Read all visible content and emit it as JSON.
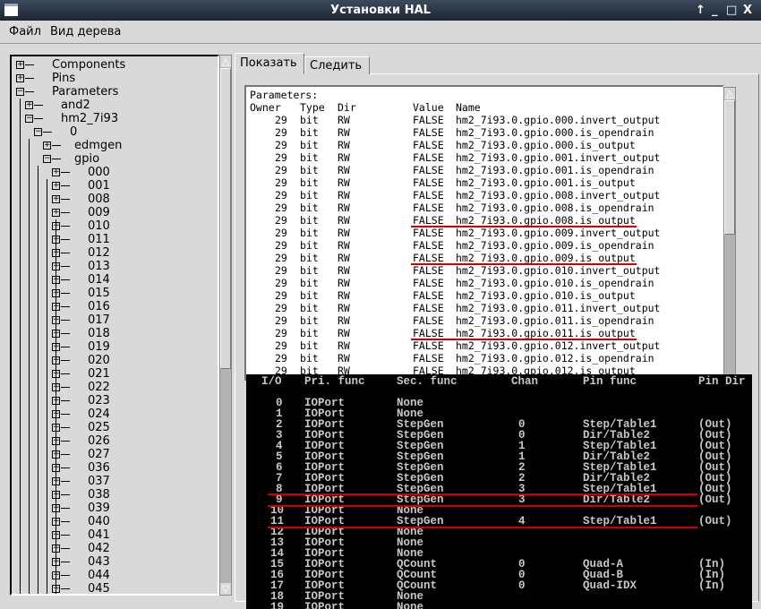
{
  "window": {
    "title": "Установки HAL",
    "controls": [
      "↑",
      "_",
      "□",
      "X"
    ]
  },
  "menu": [
    "Файл",
    "Вид дерева"
  ],
  "tree": {
    "items": [
      {
        "label": "Components",
        "depth": 0,
        "expanded": false
      },
      {
        "label": "Pins",
        "depth": 0,
        "expanded": false
      },
      {
        "label": "Parameters",
        "depth": 0,
        "expanded": true
      },
      {
        "label": "and2",
        "depth": 1,
        "expanded": false
      },
      {
        "label": "hm2_7i93",
        "depth": 1,
        "expanded": true
      },
      {
        "label": "0",
        "depth": 2,
        "expanded": true
      },
      {
        "label": "edmgen",
        "depth": 3,
        "expanded": false
      },
      {
        "label": "gpio",
        "depth": 3,
        "expanded": true
      },
      {
        "label": "000",
        "depth": 4
      },
      {
        "label": "001",
        "depth": 4
      },
      {
        "label": "008",
        "depth": 4
      },
      {
        "label": "009",
        "depth": 4
      },
      {
        "label": "010",
        "depth": 4
      },
      {
        "label": "011",
        "depth": 4
      },
      {
        "label": "012",
        "depth": 4
      },
      {
        "label": "013",
        "depth": 4
      },
      {
        "label": "014",
        "depth": 4
      },
      {
        "label": "015",
        "depth": 4
      },
      {
        "label": "016",
        "depth": 4
      },
      {
        "label": "017",
        "depth": 4
      },
      {
        "label": "018",
        "depth": 4
      },
      {
        "label": "019",
        "depth": 4
      },
      {
        "label": "020",
        "depth": 4
      },
      {
        "label": "021",
        "depth": 4
      },
      {
        "label": "022",
        "depth": 4
      },
      {
        "label": "023",
        "depth": 4
      },
      {
        "label": "024",
        "depth": 4
      },
      {
        "label": "025",
        "depth": 4
      },
      {
        "label": "026",
        "depth": 4
      },
      {
        "label": "027",
        "depth": 4
      },
      {
        "label": "036",
        "depth": 4
      },
      {
        "label": "037",
        "depth": 4
      },
      {
        "label": "038",
        "depth": 4
      },
      {
        "label": "039",
        "depth": 4
      },
      {
        "label": "040",
        "depth": 4
      },
      {
        "label": "041",
        "depth": 4
      },
      {
        "label": "042",
        "depth": 4
      },
      {
        "label": "043",
        "depth": 4
      },
      {
        "label": "044",
        "depth": 4
      },
      {
        "label": "045",
        "depth": 4
      }
    ]
  },
  "tabs": [
    {
      "label": "Показать",
      "active": true
    },
    {
      "label": "Следить",
      "active": false
    }
  ],
  "params": {
    "heading": "Parameters:",
    "columns": [
      "Owner",
      "Type",
      "Dir",
      "Value",
      "Name"
    ],
    "rows": [
      [
        "29",
        "bit",
        "RW",
        "FALSE",
        "hm2_7i93.0.gpio.000.invert_output",
        false
      ],
      [
        "29",
        "bit",
        "RW",
        "FALSE",
        "hm2_7i93.0.gpio.000.is_opendrain",
        false
      ],
      [
        "29",
        "bit",
        "RW",
        "FALSE",
        "hm2_7i93.0.gpio.000.is_output",
        false
      ],
      [
        "29",
        "bit",
        "RW",
        "FALSE",
        "hm2_7i93.0.gpio.001.invert_output",
        false
      ],
      [
        "29",
        "bit",
        "RW",
        "FALSE",
        "hm2_7i93.0.gpio.001.is_opendrain",
        false
      ],
      [
        "29",
        "bit",
        "RW",
        "FALSE",
        "hm2_7i93.0.gpio.001.is_output",
        false
      ],
      [
        "29",
        "bit",
        "RW",
        "FALSE",
        "hm2_7i93.0.gpio.008.invert_output",
        false
      ],
      [
        "29",
        "bit",
        "RW",
        "FALSE",
        "hm2_7i93.0.gpio.008.is_opendrain",
        false
      ],
      [
        "29",
        "bit",
        "RW",
        "FALSE",
        "hm2_7i93.0.gpio.008.is_output",
        true
      ],
      [
        "29",
        "bit",
        "RW",
        "FALSE",
        "hm2_7i93.0.gpio.009.invert_output",
        false
      ],
      [
        "29",
        "bit",
        "RW",
        "FALSE",
        "hm2_7i93.0.gpio.009.is_opendrain",
        false
      ],
      [
        "29",
        "bit",
        "RW",
        "FALSE",
        "hm2_7i93.0.gpio.009.is_output",
        true
      ],
      [
        "29",
        "bit",
        "RW",
        "FALSE",
        "hm2_7i93.0.gpio.010.invert_output",
        false
      ],
      [
        "29",
        "bit",
        "RW",
        "FALSE",
        "hm2_7i93.0.gpio.010.is_opendrain",
        false
      ],
      [
        "29",
        "bit",
        "RW",
        "FALSE",
        "hm2_7i93.0.gpio.010.is_output",
        false
      ],
      [
        "29",
        "bit",
        "RW",
        "FALSE",
        "hm2_7i93.0.gpio.011.invert_output",
        false
      ],
      [
        "29",
        "bit",
        "RW",
        "FALSE",
        "hm2_7i93.0.gpio.011.is_opendrain",
        false
      ],
      [
        "29",
        "bit",
        "RW",
        "FALSE",
        "hm2_7i93.0.gpio.011.is_output",
        true
      ],
      [
        "29",
        "bit",
        "RW",
        "FALSE",
        "hm2_7i93.0.gpio.012.invert_output",
        false
      ],
      [
        "29",
        "bit",
        "RW",
        "FALSE",
        "hm2_7i93.0.gpio.012.is_opendrain",
        false
      ],
      [
        "29",
        "bit",
        "RW",
        "FALSE",
        "hm2_7i93.0.gpio.012.is_output",
        false
      ]
    ]
  },
  "pinout": {
    "columns": [
      "I/O",
      "Pri. func",
      "Sec. func",
      "Chan",
      "Pin func",
      "Pin Dir"
    ],
    "rows": [
      [
        "0",
        "IOPort",
        "None",
        "",
        "",
        ""
      ],
      [
        "1",
        "IOPort",
        "None",
        "",
        "",
        ""
      ],
      [
        "2",
        "IOPort",
        "StepGen",
        "0",
        "Step/Table1",
        "(Out)"
      ],
      [
        "3",
        "IOPort",
        "StepGen",
        "0",
        "Dir/Table2",
        "(Out)"
      ],
      [
        "4",
        "IOPort",
        "StepGen",
        "1",
        "Step/Table1",
        "(Out)"
      ],
      [
        "5",
        "IOPort",
        "StepGen",
        "1",
        "Dir/Table2",
        "(Out)"
      ],
      [
        "6",
        "IOPort",
        "StepGen",
        "2",
        "Step/Table1",
        "(Out)"
      ],
      [
        "7",
        "IOPort",
        "StepGen",
        "2",
        "Dir/Table2",
        "(Out)"
      ],
      [
        "8",
        "IOPort",
        "StepGen",
        "3",
        "Step/Table1",
        "(Out)"
      ],
      [
        "9",
        "IOPort",
        "StepGen",
        "3",
        "Dir/Table2",
        "(Out)"
      ],
      [
        "10",
        "IOPort",
        "None",
        "",
        "",
        ""
      ],
      [
        "11",
        "IOPort",
        "StepGen",
        "4",
        "Step/Table1",
        "(Out)"
      ],
      [
        "12",
        "IOPort",
        "None",
        "",
        "",
        ""
      ],
      [
        "13",
        "IOPort",
        "None",
        "",
        "",
        ""
      ],
      [
        "14",
        "IOPort",
        "None",
        "",
        "",
        ""
      ],
      [
        "15",
        "IOPort",
        "QCount",
        "0",
        "Quad-A",
        "(In)"
      ],
      [
        "16",
        "IOPort",
        "QCount",
        "0",
        "Quad-B",
        "(In)"
      ],
      [
        "17",
        "IOPort",
        "QCount",
        "0",
        "Quad-IDX",
        "(In)"
      ],
      [
        "18",
        "IOPort",
        "None",
        "",
        "",
        ""
      ],
      [
        "19",
        "IOPort",
        "None",
        "",
        "",
        ""
      ]
    ],
    "highlighted_io": [
      "9",
      "11"
    ]
  },
  "colors": {
    "highlight": "#d00000",
    "titlebar": "#2a3545"
  }
}
